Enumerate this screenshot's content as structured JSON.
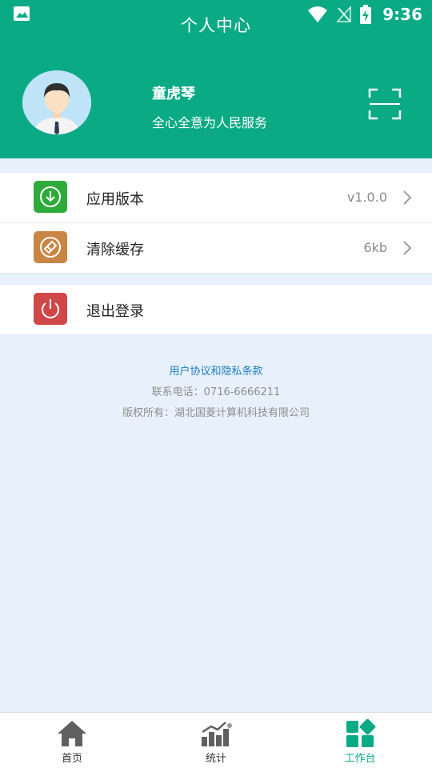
{
  "status_bar": {
    "time": "9:36"
  },
  "header": {
    "title": "个人中心"
  },
  "profile": {
    "name": "童虎琴",
    "motto": "全心全意为人民服务"
  },
  "menu": [
    {
      "label": "应用版本",
      "value": "v1.0.0",
      "icon": "download-icon",
      "color": "#2eaa3a"
    },
    {
      "label": "清除缓存",
      "value": "6kb",
      "icon": "eraser-icon",
      "color": "#c98544"
    },
    {
      "label": "退出登录",
      "value": "",
      "icon": "power-icon",
      "color": "#d04748"
    }
  ],
  "info": {
    "agreement": "用户协议和隐私条款",
    "contact": "联系电话：0716-6666211",
    "copyright": "版权所有：湖北国菱计算机科技有限公司"
  },
  "bottom_nav": [
    {
      "label": "首页",
      "icon": "home-icon"
    },
    {
      "label": "统计",
      "icon": "chart-icon"
    },
    {
      "label": "工作台",
      "icon": "workbench-icon",
      "active": true
    }
  ],
  "colors": {
    "primary": "#0aaa85",
    "background": "#e8f0fc",
    "link": "#1a7fc1"
  }
}
